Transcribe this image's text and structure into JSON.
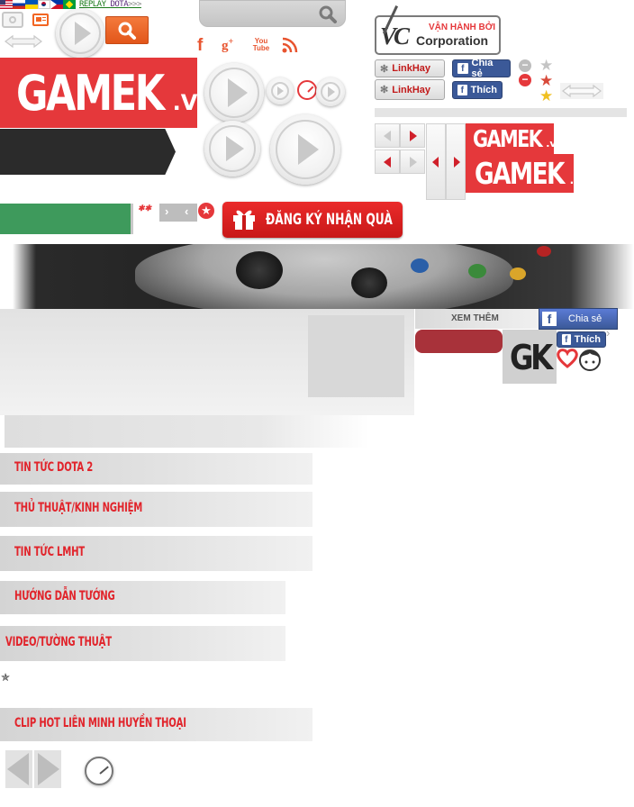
{
  "top_links": {
    "replay": "REPLAY",
    "dota": "DOTA",
    "arrows": ">>>"
  },
  "social_icons": [
    "facebook-icon",
    "google-plus-icon",
    "youtube-icon",
    "rss-icon"
  ],
  "youtube_label": {
    "line1": "You",
    "line2": "Tube"
  },
  "vc_corp": {
    "top_text": "VẬN HÀNH BỞI",
    "main_text": "Corporation",
    "logo_letters": "VC"
  },
  "share": {
    "linkhay": "LinkHay",
    "chia_se": "Chia sẻ",
    "thich": "Thích"
  },
  "brand": {
    "name": "GAMEK",
    "tld": ".VN",
    "tld_small": ".vn",
    "gk_logo": "GK"
  },
  "register_button": "ĐĂNG KÝ NHẬN QUÀ",
  "xem_them": "XEM THÊM",
  "categories": [
    "TIN TỨC DOTA 2",
    "THỦ THUẬT/KINH NGHIỆM",
    "TIN TỨC LMHT",
    "HƯỚNG DẪN TƯỚNG",
    "VIDEO/TƯỜNG THUẬT",
    "CLIP HOT LIÊN MINH HUYỀN THOẠI"
  ],
  "colors": {
    "brand_red": "#e5383b",
    "dark_bar": "#2b2b2b",
    "green_bar": "#3e9a5c",
    "facebook_blue": "#3b5998",
    "category_text": "#e1242b",
    "search_orange": "#f26522"
  }
}
